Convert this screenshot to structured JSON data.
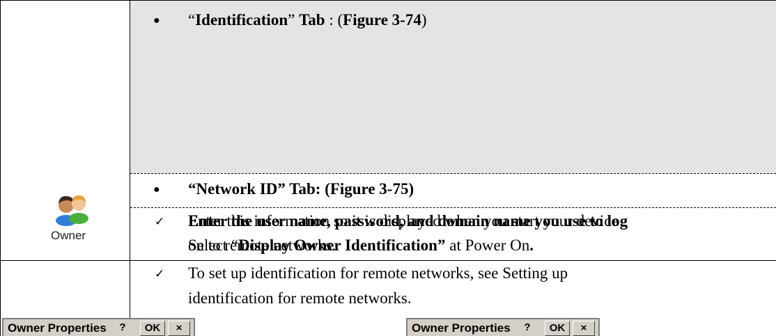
{
  "row1": {
    "bullet": "●",
    "open_quote": "“",
    "tab_name": "Identification",
    "close_quote": "” ",
    "tab_word": "Tab",
    "separator": " : (",
    "figure": "Figure 3-74",
    "close_paren": ")"
  },
  "row2": {
    "bullet": "●",
    "text": "“Network ID” Tab: (Figure 3-75)"
  },
  "owner": {
    "icon": "owner-users-icon",
    "label": "Owner"
  },
  "row3": {
    "check": "✓",
    "line1_a": "Enter the user name, password, and domain name you use to log",
    "line1_b": "Enter this information so it is displayed when you start your device",
    "line2_a": "on to remote networks.",
    "line2_b_pre": "Select “",
    "line2_b_bold": "Display Owner Identification”",
    "line2_b_mid": " at Power On",
    "line2_b_dot": "."
  },
  "row4": {
    "check": "✓",
    "line1": "To set up identification for remote networks, see Setting up",
    "line2": "identification for remote networks."
  },
  "dialogs": [
    {
      "title": "Owner Properties",
      "help": "?",
      "ok": "OK",
      "close": "×"
    },
    {
      "title": "Owner Properties",
      "help": "?",
      "ok": "OK",
      "close": "×"
    }
  ],
  "colors": {
    "shade": "#e4e4e4",
    "titlebar": "#d4d0c8"
  }
}
